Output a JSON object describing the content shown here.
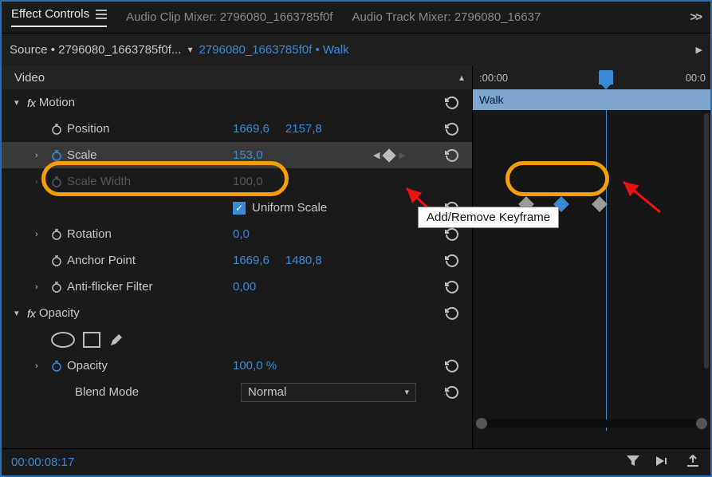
{
  "tabs": {
    "effect_controls": "Effect Controls",
    "audio_clip_mixer": "Audio Clip Mixer: 2796080_1663785f0f",
    "audio_track_mixer": "Audio Track Mixer: 2796080_16637"
  },
  "source": {
    "left": "Source • 2796080_1663785f0f...",
    "right": "2796080_1663785f0f • Walk"
  },
  "ruler": {
    "t0": ":00:00",
    "t1": "00:0"
  },
  "clip_name": "Walk",
  "video_header": "Video",
  "motion": {
    "label": "Motion",
    "position": {
      "label": "Position",
      "x": "1669,6",
      "y": "2157,8"
    },
    "scale": {
      "label": "Scale",
      "value": "153,0"
    },
    "scale_width": {
      "label": "Scale Width",
      "value": "100,0"
    },
    "uniform_scale": "Uniform Scale",
    "rotation": {
      "label": "Rotation",
      "value": "0,0"
    },
    "anchor": {
      "label": "Anchor Point",
      "x": "1669,6",
      "y": "1480,8"
    },
    "antiflicker": {
      "label": "Anti-flicker Filter",
      "value": "0,00"
    }
  },
  "opacity": {
    "label": "Opacity",
    "value_label": "Opacity",
    "value": "100,0 %",
    "blend_label": "Blend Mode",
    "blend_value": "Normal"
  },
  "tooltip": "Add/Remove Keyframe",
  "timecode": "00:00:08:17"
}
